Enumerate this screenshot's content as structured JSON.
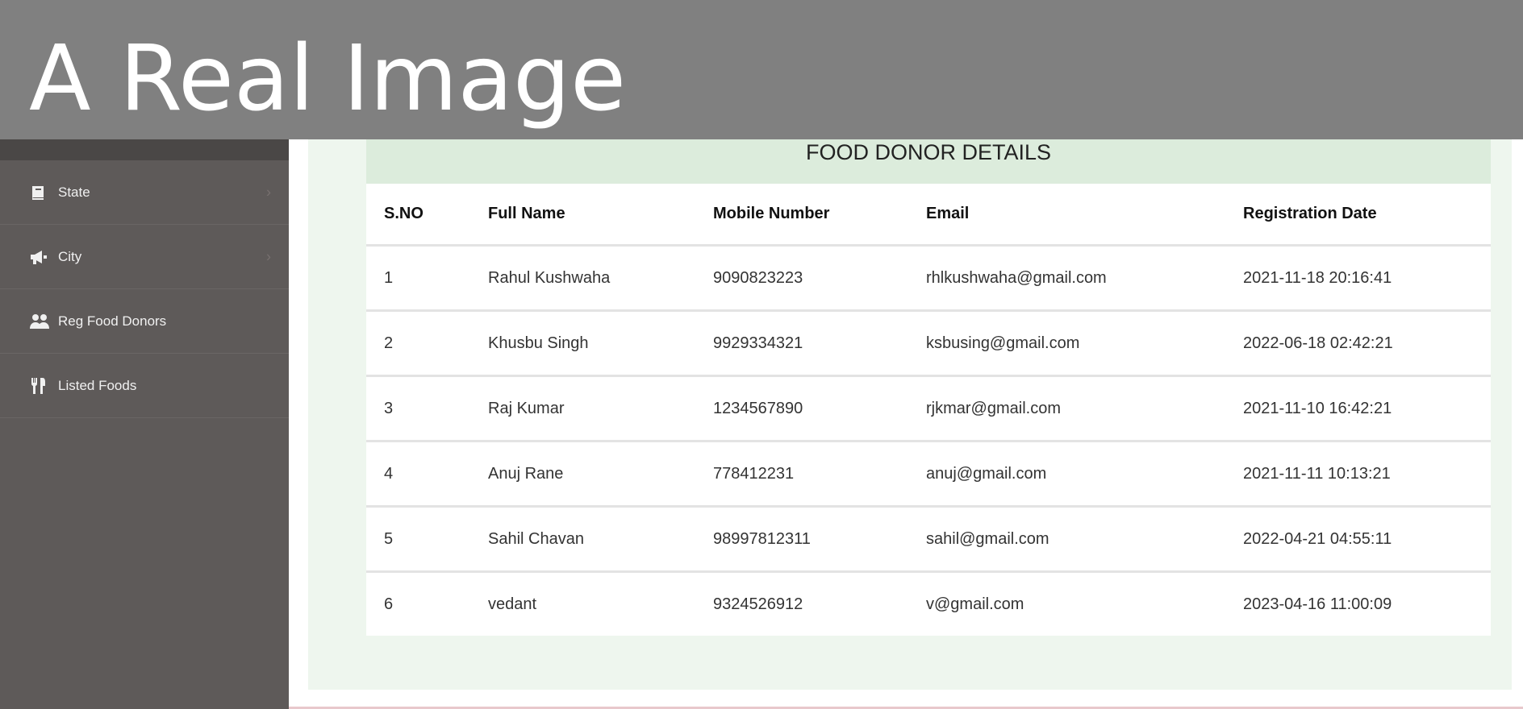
{
  "overlay": {
    "text": "A Real Image"
  },
  "sidebar": {
    "items": [
      {
        "label": "State",
        "icon": "book-icon",
        "has_chevron": true
      },
      {
        "label": "City",
        "icon": "megaphone-icon",
        "has_chevron": true
      },
      {
        "label": "Reg Food Donors",
        "icon": "users-icon",
        "has_chevron": false
      },
      {
        "label": "Listed Foods",
        "icon": "cutlery-icon",
        "has_chevron": false
      }
    ]
  },
  "table": {
    "title": "FOOD DONOR DETAILS",
    "headers": [
      "S.NO",
      "Full Name",
      "Mobile Number",
      "Email",
      "Registration Date"
    ],
    "rows": [
      [
        "1",
        "Rahul Kushwaha",
        "9090823223",
        "rhlkushwaha@gmail.com",
        "2021-11-18 20:16:41"
      ],
      [
        "2",
        "Khusbu Singh",
        "9929334321",
        "ksbusing@gmail.com",
        "2022-06-18 02:42:21"
      ],
      [
        "3",
        "Raj Kumar",
        "1234567890",
        "rjkmar@gmail.com",
        "2021-11-10 16:42:21"
      ],
      [
        "4",
        "Anuj Rane",
        "778412231",
        "anuj@gmail.com",
        "2021-11-11 10:13:21"
      ],
      [
        "5",
        "Sahil Chavan",
        "98997812311",
        "sahil@gmail.com",
        "2022-04-21 04:55:11"
      ],
      [
        "6",
        "vedant",
        "9324526912",
        "v@gmail.com",
        "2023-04-16 11:00:09"
      ]
    ]
  },
  "colors": {
    "sidebar_bg": "#5e5a59",
    "panel_bg": "#eef6ee",
    "title_bg": "#dcecdc",
    "overlay_bg": "#808080"
  }
}
